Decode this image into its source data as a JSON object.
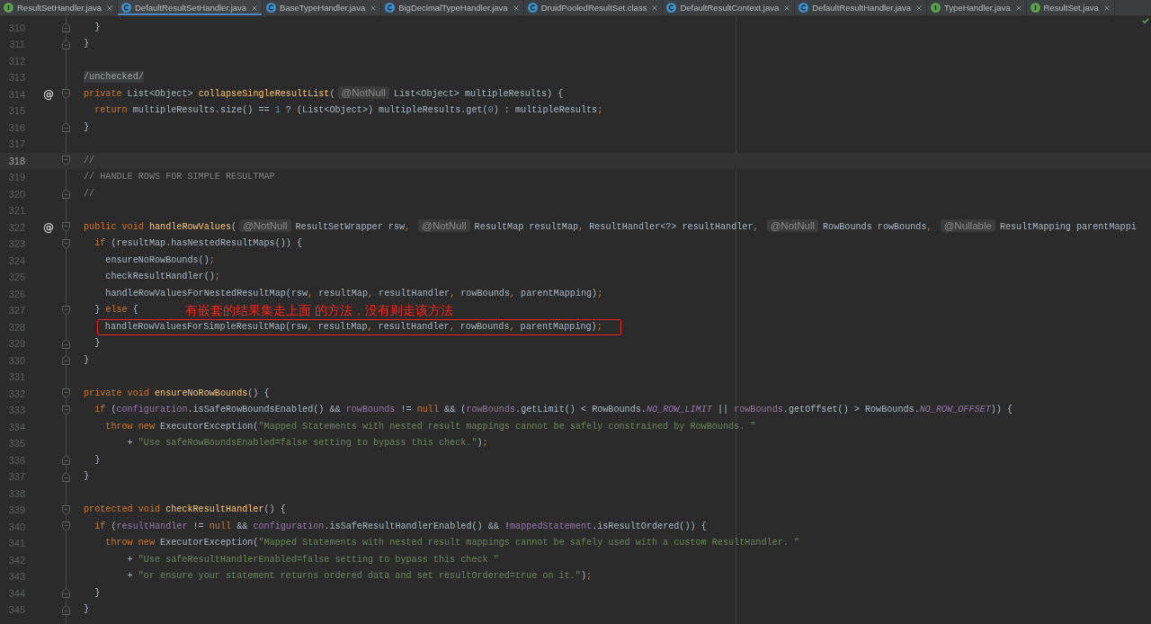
{
  "tabs": [
    {
      "label": "ResultSetHandler.java",
      "kind": "interface",
      "selected": false
    },
    {
      "label": "DefaultResultSetHandler.java",
      "kind": "class",
      "selected": true
    },
    {
      "label": "BaseTypeHandler.java",
      "kind": "class",
      "selected": false
    },
    {
      "label": "BigDecimalTypeHandler.java",
      "kind": "class",
      "selected": false
    },
    {
      "label": "DruidPooledResultSet.class",
      "kind": "class",
      "selected": false
    },
    {
      "label": "DefaultResultContext.java",
      "kind": "class",
      "selected": false
    },
    {
      "label": "DefaultResultHandler.java",
      "kind": "class",
      "selected": false
    },
    {
      "label": "TypeHandler.java",
      "kind": "interface",
      "selected": false
    },
    {
      "label": "ResultSet.java",
      "kind": "interface",
      "selected": false
    }
  ],
  "editor": {
    "lines": [
      {
        "number": "310",
        "fold": {
          "kind": "end"
        },
        "current": false,
        "boxed": false,
        "tokens": [
          {
            "kind": "plain",
            "text": "  }"
          }
        ]
      },
      {
        "number": "311",
        "fold": {
          "kind": "end"
        },
        "current": false,
        "boxed": false,
        "tokens": [
          {
            "kind": "plain",
            "text": "}"
          }
        ]
      },
      {
        "number": "312",
        "current": false,
        "boxed": false
      },
      {
        "number": "313",
        "current": false,
        "boxed": false,
        "tokens": [
          {
            "kind": "folded",
            "text": "/unchecked/"
          }
        ]
      },
      {
        "number": "314",
        "mark": "@",
        "fold": {
          "kind": "start"
        },
        "current": false,
        "boxed": false,
        "tokens": [
          {
            "kind": "keyword",
            "text": "private"
          },
          {
            "kind": "plain",
            "text": " List<Object> "
          },
          {
            "kind": "method",
            "text": "collapseSingleResultList"
          },
          {
            "kind": "plain",
            "text": "("
          },
          {
            "kind": "annotation",
            "text": "@NotNull"
          },
          {
            "kind": "plain",
            "text": "List<Object> multipleResults) {"
          }
        ]
      },
      {
        "number": "315",
        "current": false,
        "boxed": false,
        "tokens": [
          {
            "kind": "keyword",
            "text": "  return"
          },
          {
            "kind": "plain",
            "text": " multipleResults.size() == "
          },
          {
            "kind": "number",
            "text": "1"
          },
          {
            "kind": "plain",
            "text": " ? (List<Object>) multipleResults.get("
          },
          {
            "kind": "number",
            "text": "0"
          },
          {
            "kind": "plain",
            "text": ") : multipleResults"
          },
          {
            "kind": "punct",
            "text": ";"
          }
        ]
      },
      {
        "number": "316",
        "fold": {
          "kind": "end"
        },
        "current": false,
        "boxed": false,
        "tokens": [
          {
            "kind": "plain",
            "text": "}"
          }
        ]
      },
      {
        "number": "317",
        "current": false,
        "boxed": false
      },
      {
        "number": "318",
        "fold": {
          "kind": "start"
        },
        "current": true,
        "boxed": false,
        "tokens": [
          {
            "kind": "comment",
            "text": "//"
          }
        ]
      },
      {
        "number": "319",
        "current": false,
        "boxed": false,
        "tokens": [
          {
            "kind": "comment",
            "text": "// HANDLE ROWS FOR SIMPLE RESULTMAP"
          }
        ]
      },
      {
        "number": "320",
        "fold": {
          "kind": "end"
        },
        "current": false,
        "boxed": false,
        "tokens": [
          {
            "kind": "comment",
            "text": "//"
          }
        ]
      },
      {
        "number": "321",
        "current": false,
        "boxed": false
      },
      {
        "number": "322",
        "mark": "@",
        "fold": {
          "kind": "start"
        },
        "current": false,
        "boxed": false,
        "tokens": [
          {
            "kind": "keyword",
            "text": "public void "
          },
          {
            "kind": "method",
            "text": "handleRowValues"
          },
          {
            "kind": "plain",
            "text": "("
          },
          {
            "kind": "annotation",
            "text": "@NotNull"
          },
          {
            "kind": "plain",
            "text": "ResultSetWrapper rsw"
          },
          {
            "kind": "punct",
            "text": ", "
          },
          {
            "kind": "annotation",
            "text": "@NotNull"
          },
          {
            "kind": "plain",
            "text": "ResultMap resultMap"
          },
          {
            "kind": "punct",
            "text": ","
          },
          {
            "kind": "plain",
            "text": " ResultHandler<?> resultHandler"
          },
          {
            "kind": "punct",
            "text": ", "
          },
          {
            "kind": "annotation",
            "text": "@NotNull"
          },
          {
            "kind": "plain",
            "text": "RowBounds rowBounds"
          },
          {
            "kind": "punct",
            "text": ", "
          },
          {
            "kind": "annotation",
            "text": "@Nullable"
          },
          {
            "kind": "plain",
            "text": "ResultMapping parentMappi"
          }
        ]
      },
      {
        "number": "323",
        "fold": {
          "kind": "start"
        },
        "current": false,
        "boxed": false,
        "tokens": [
          {
            "kind": "keyword",
            "text": "  if"
          },
          {
            "kind": "plain",
            "text": " (resultMap.hasNestedResultMaps()) {"
          }
        ]
      },
      {
        "number": "324",
        "current": false,
        "boxed": false,
        "tokens": [
          {
            "kind": "plain",
            "text": "    ensureNoRowBounds()"
          },
          {
            "kind": "punct",
            "text": ";"
          }
        ]
      },
      {
        "number": "325",
        "current": false,
        "boxed": false,
        "tokens": [
          {
            "kind": "plain",
            "text": "    checkResultHandler()"
          },
          {
            "kind": "punct",
            "text": ";"
          }
        ]
      },
      {
        "number": "326",
        "current": false,
        "boxed": false,
        "tokens": [
          {
            "kind": "plain",
            "text": "    handleRowValuesForNestedResultMap(rsw"
          },
          {
            "kind": "punct",
            "text": ","
          },
          {
            "kind": "plain",
            "text": " resultMap"
          },
          {
            "kind": "punct",
            "text": ","
          },
          {
            "kind": "plain",
            "text": " resultHandler"
          },
          {
            "kind": "punct",
            "text": ","
          },
          {
            "kind": "plain",
            "text": " rowBounds"
          },
          {
            "kind": "punct",
            "text": ","
          },
          {
            "kind": "plain",
            "text": " parentMapping)"
          },
          {
            "kind": "punct",
            "text": ";"
          }
        ]
      },
      {
        "number": "327",
        "fold": {
          "kind": "start"
        },
        "current": false,
        "boxed": false,
        "tokens": [
          {
            "kind": "plain",
            "text": "  } "
          },
          {
            "kind": "keyword",
            "text": "else"
          },
          {
            "kind": "plain",
            "text": " {"
          }
        ],
        "note": "有嵌套的结果集走上面 的方法，没有则走该方法"
      },
      {
        "number": "328",
        "current": false,
        "boxed": true,
        "tokens": [
          {
            "kind": "plain",
            "text": "    handleRowValuesForSimpleResultMap(rsw"
          },
          {
            "kind": "punct",
            "text": ","
          },
          {
            "kind": "plain",
            "text": " resultMap"
          },
          {
            "kind": "punct",
            "text": ","
          },
          {
            "kind": "plain",
            "text": " resultHandler"
          },
          {
            "kind": "punct",
            "text": ","
          },
          {
            "kind": "plain",
            "text": " rowBounds"
          },
          {
            "kind": "punct",
            "text": ","
          },
          {
            "kind": "plain",
            "text": " parentMapping)"
          },
          {
            "kind": "punct",
            "text": ";"
          }
        ]
      },
      {
        "number": "329",
        "fold": {
          "kind": "end"
        },
        "current": false,
        "boxed": false,
        "tokens": [
          {
            "kind": "plain",
            "text": "  }"
          }
        ]
      },
      {
        "number": "330",
        "fold": {
          "kind": "end"
        },
        "current": false,
        "boxed": false,
        "tokens": [
          {
            "kind": "plain",
            "text": "}"
          }
        ]
      },
      {
        "number": "331",
        "current": false,
        "boxed": false
      },
      {
        "number": "332",
        "fold": {
          "kind": "start"
        },
        "current": false,
        "boxed": false,
        "tokens": [
          {
            "kind": "keyword",
            "text": "private void "
          },
          {
            "kind": "method",
            "text": "ensureNoRowBounds"
          },
          {
            "kind": "plain",
            "text": "() {"
          }
        ]
      },
      {
        "number": "333",
        "fold": {
          "kind": "start"
        },
        "current": false,
        "boxed": false,
        "tokens": [
          {
            "kind": "keyword",
            "text": "  if"
          },
          {
            "kind": "plain",
            "text": " ("
          },
          {
            "kind": "field",
            "text": "configuration"
          },
          {
            "kind": "plain",
            "text": ".isSafeRowBoundsEnabled() && "
          },
          {
            "kind": "field",
            "text": "rowBounds"
          },
          {
            "kind": "plain",
            "text": " != "
          },
          {
            "kind": "keyword",
            "text": "null"
          },
          {
            "kind": "plain",
            "text": " && ("
          },
          {
            "kind": "field",
            "text": "rowBounds"
          },
          {
            "kind": "plain",
            "text": ".getLimit() < RowBounds."
          },
          {
            "kind": "constant",
            "text": "NO_ROW_LIMIT"
          },
          {
            "kind": "plain",
            "text": " || "
          },
          {
            "kind": "field",
            "text": "rowBounds"
          },
          {
            "kind": "plain",
            "text": ".getOffset() > RowBounds."
          },
          {
            "kind": "constant",
            "text": "NO_ROW_OFFSET"
          },
          {
            "kind": "plain",
            "text": ")) {"
          }
        ]
      },
      {
        "number": "334",
        "current": false,
        "boxed": false,
        "tokens": [
          {
            "kind": "keyword",
            "text": "    throw new"
          },
          {
            "kind": "plain",
            "text": " ExecutorException("
          },
          {
            "kind": "string",
            "text": "\"Mapped Statements with nested result mappings cannot be safely constrained by RowBounds. \""
          }
        ]
      },
      {
        "number": "335",
        "current": false,
        "boxed": false,
        "tokens": [
          {
            "kind": "plain",
            "text": "        + "
          },
          {
            "kind": "string",
            "text": "\"Use safeRowBoundsEnabled=false setting to bypass this check.\""
          },
          {
            "kind": "plain",
            "text": ")"
          },
          {
            "kind": "punct",
            "text": ";"
          }
        ]
      },
      {
        "number": "336",
        "fold": {
          "kind": "end"
        },
        "current": false,
        "boxed": false,
        "tokens": [
          {
            "kind": "plain",
            "text": "  }"
          }
        ]
      },
      {
        "number": "337",
        "fold": {
          "kind": "end"
        },
        "current": false,
        "boxed": false,
        "tokens": [
          {
            "kind": "plain",
            "text": "}"
          }
        ]
      },
      {
        "number": "338",
        "current": false,
        "boxed": false
      },
      {
        "number": "339",
        "fold": {
          "kind": "start"
        },
        "current": false,
        "boxed": false,
        "tokens": [
          {
            "kind": "keyword",
            "text": "protected void "
          },
          {
            "kind": "method",
            "text": "checkResultHandler"
          },
          {
            "kind": "plain",
            "text": "() {"
          }
        ]
      },
      {
        "number": "340",
        "fold": {
          "kind": "start"
        },
        "current": false,
        "boxed": false,
        "tokens": [
          {
            "kind": "keyword",
            "text": "  if"
          },
          {
            "kind": "plain",
            "text": " ("
          },
          {
            "kind": "field",
            "text": "resultHandler"
          },
          {
            "kind": "plain",
            "text": " != "
          },
          {
            "kind": "keyword",
            "text": "null"
          },
          {
            "kind": "plain",
            "text": " && "
          },
          {
            "kind": "field",
            "text": "configuration"
          },
          {
            "kind": "plain",
            "text": ".isSafeResultHandlerEnabled() && !"
          },
          {
            "kind": "field",
            "text": "mappedStatement"
          },
          {
            "kind": "plain",
            "text": ".isResultOrdered()) {"
          }
        ]
      },
      {
        "number": "341",
        "current": false,
        "boxed": false,
        "tokens": [
          {
            "kind": "keyword",
            "text": "    throw new"
          },
          {
            "kind": "plain",
            "text": " ExecutorException("
          },
          {
            "kind": "string",
            "text": "\"Mapped Statements with nested result mappings cannot be safely used with a custom ResultHandler. \""
          }
        ]
      },
      {
        "number": "342",
        "current": false,
        "boxed": false,
        "tokens": [
          {
            "kind": "plain",
            "text": "        + "
          },
          {
            "kind": "string",
            "text": "\"Use safeResultHandlerEnabled=false setting to bypass this check \""
          }
        ]
      },
      {
        "number": "343",
        "current": false,
        "boxed": false,
        "tokens": [
          {
            "kind": "plain",
            "text": "        + "
          },
          {
            "kind": "string",
            "text": "\"or ensure your statement returns ordered data and set resultOrdered=true on it.\""
          },
          {
            "kind": "plain",
            "text": ")"
          },
          {
            "kind": "punct",
            "text": ";"
          }
        ]
      },
      {
        "number": "344",
        "fold": {
          "kind": "end"
        },
        "current": false,
        "boxed": false,
        "tokens": [
          {
            "kind": "plain",
            "text": "  }"
          }
        ]
      },
      {
        "number": "345",
        "fold": {
          "kind": "end"
        },
        "current": false,
        "boxed": false,
        "tokens": [
          {
            "kind": "plain",
            "text": "}"
          }
        ]
      }
    ]
  }
}
